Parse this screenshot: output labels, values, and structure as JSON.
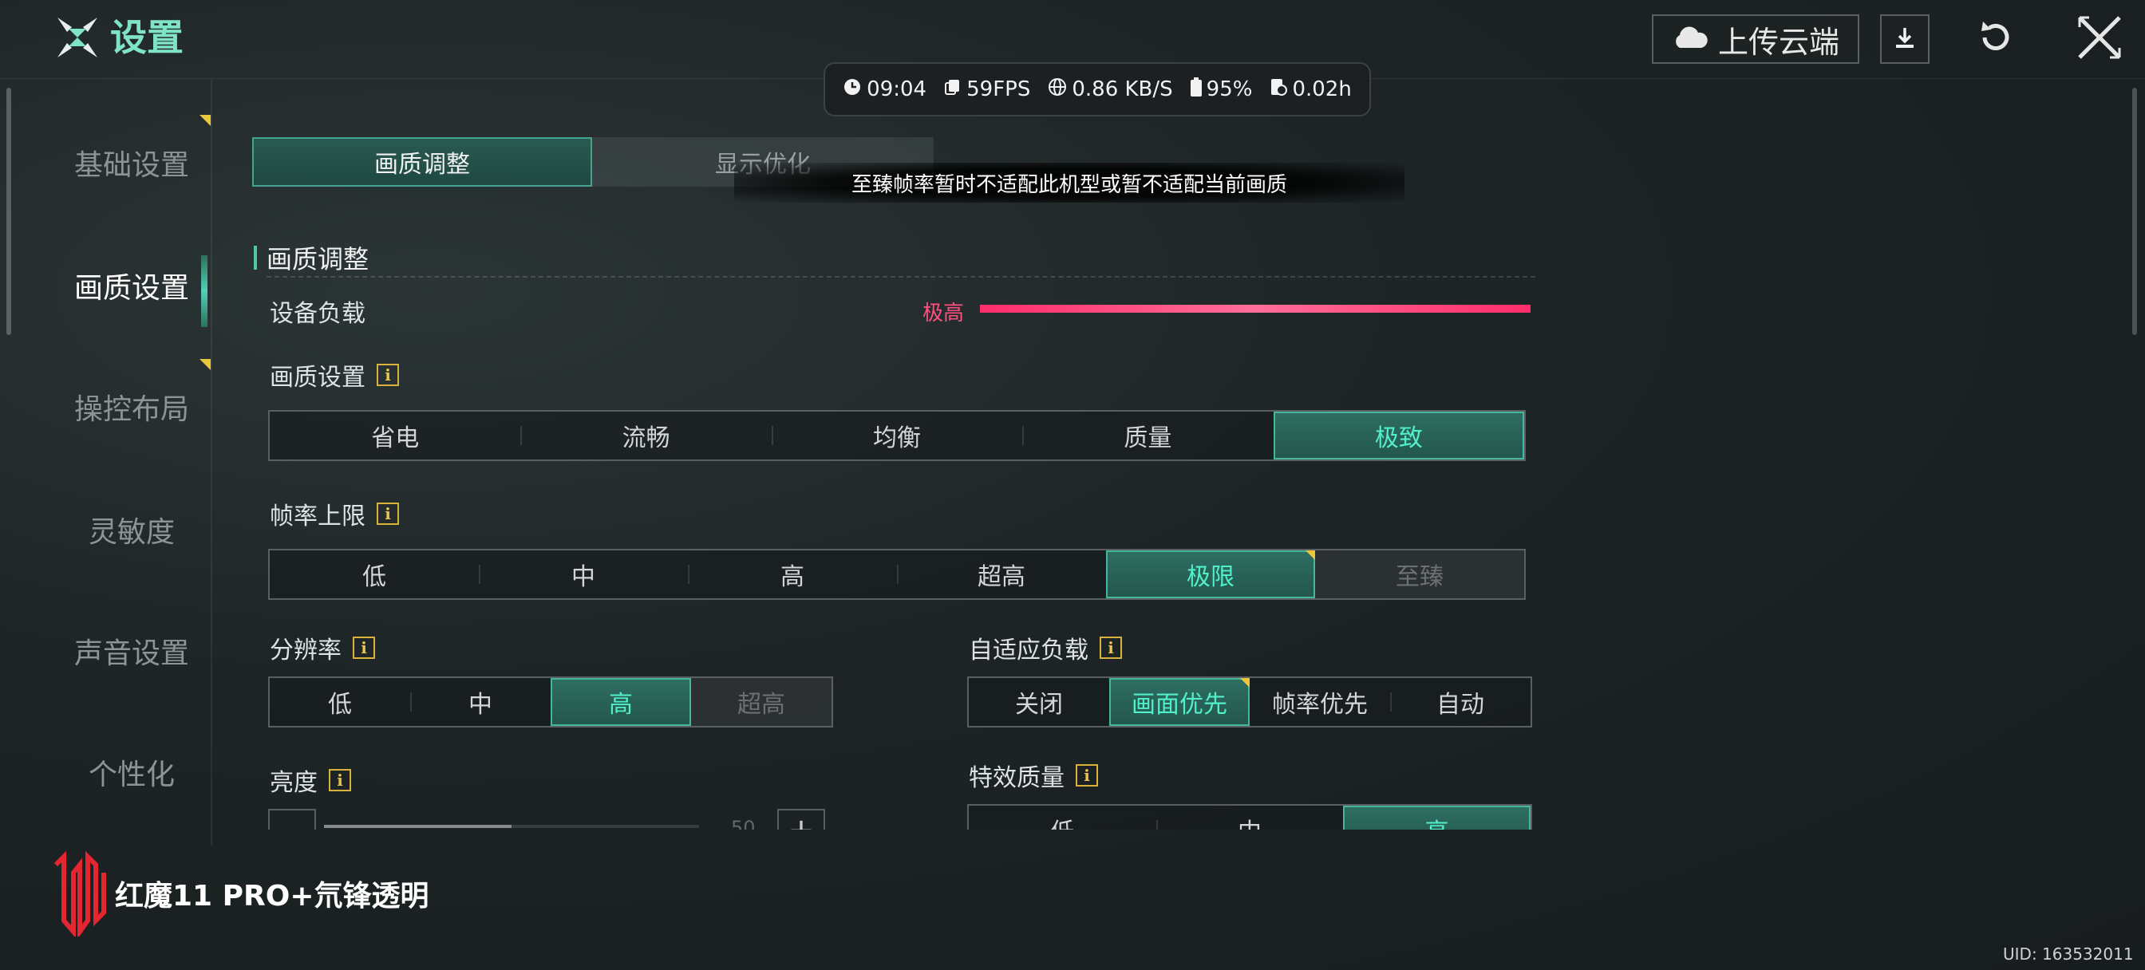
{
  "header": {
    "title": "设置",
    "upload_label": "上传云端"
  },
  "perf": {
    "time": "09:04",
    "fps": "59FPS",
    "network": "0.86 KB/S",
    "battery": "95%",
    "duration": "0.02h"
  },
  "sidebar": {
    "items": [
      {
        "label": "基础设置"
      },
      {
        "label": "画质设置"
      },
      {
        "label": "操控布局"
      },
      {
        "label": "灵敏度"
      },
      {
        "label": "声音设置"
      },
      {
        "label": "个性化"
      }
    ],
    "active": "画质设置"
  },
  "tabs": [
    {
      "label": "画质调整"
    },
    {
      "label": "显示优化"
    }
  ],
  "toast": "至臻帧率暂时不适配此机型或暂不适配当前画质",
  "section": {
    "title": "画质调整",
    "device_load": {
      "label": "设备负载",
      "value": "极高",
      "level": 1.0
    }
  },
  "quality": {
    "label": "画质设置",
    "options": [
      "省电",
      "流畅",
      "均衡",
      "质量",
      "极致"
    ],
    "selected": "极致"
  },
  "fps": {
    "label": "帧率上限",
    "options": [
      "低",
      "中",
      "高",
      "超高",
      "极限",
      "至臻"
    ],
    "selected": "极限",
    "disabled": "至臻"
  },
  "resolution": {
    "label": "分辨率",
    "options": [
      "低",
      "中",
      "高",
      "超高"
    ],
    "selected": "高",
    "disabled": "超高"
  },
  "adaptive_load": {
    "label": "自适应负载",
    "options": [
      "关闭",
      "画面优先",
      "帧率优先",
      "自动"
    ],
    "selected": "画面优先"
  },
  "brightness": {
    "label": "亮度",
    "value": "50",
    "plus": "+"
  },
  "effect_quality": {
    "label": "特效质量",
    "options": [
      "低",
      "中",
      "高"
    ],
    "selected": "高"
  },
  "brand": "红魔11 PRO+氘锋透明",
  "uid": "UID: 163532011",
  "colors": {
    "accent": "#52f0c8",
    "load_high": "#ff3b74",
    "hint": "#e9c83c"
  }
}
